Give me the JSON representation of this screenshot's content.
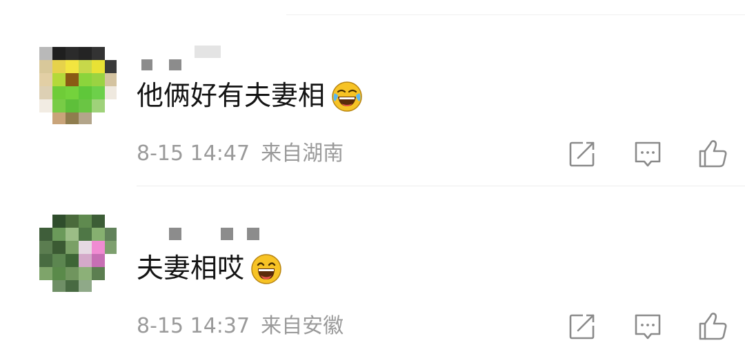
{
  "comments": [
    {
      "text": "他俩好有夫妻相",
      "emoji": "laughing-tears-emoji",
      "time": "8-15 14:47",
      "location": "来自湖南"
    },
    {
      "text": "夫妻相哎",
      "emoji": "big-laugh-emoji",
      "time": "8-15 14:37",
      "location": "来自安徽"
    }
  ],
  "icons": {
    "share": "share-icon",
    "reply": "comment-icon",
    "like": "thumbs-up-icon"
  },
  "colors": {
    "text": "#141414",
    "meta": "#9a9a9a",
    "icon": "#8a8a8a",
    "divider": "#ececec",
    "emoji_face": "#f7c325"
  }
}
